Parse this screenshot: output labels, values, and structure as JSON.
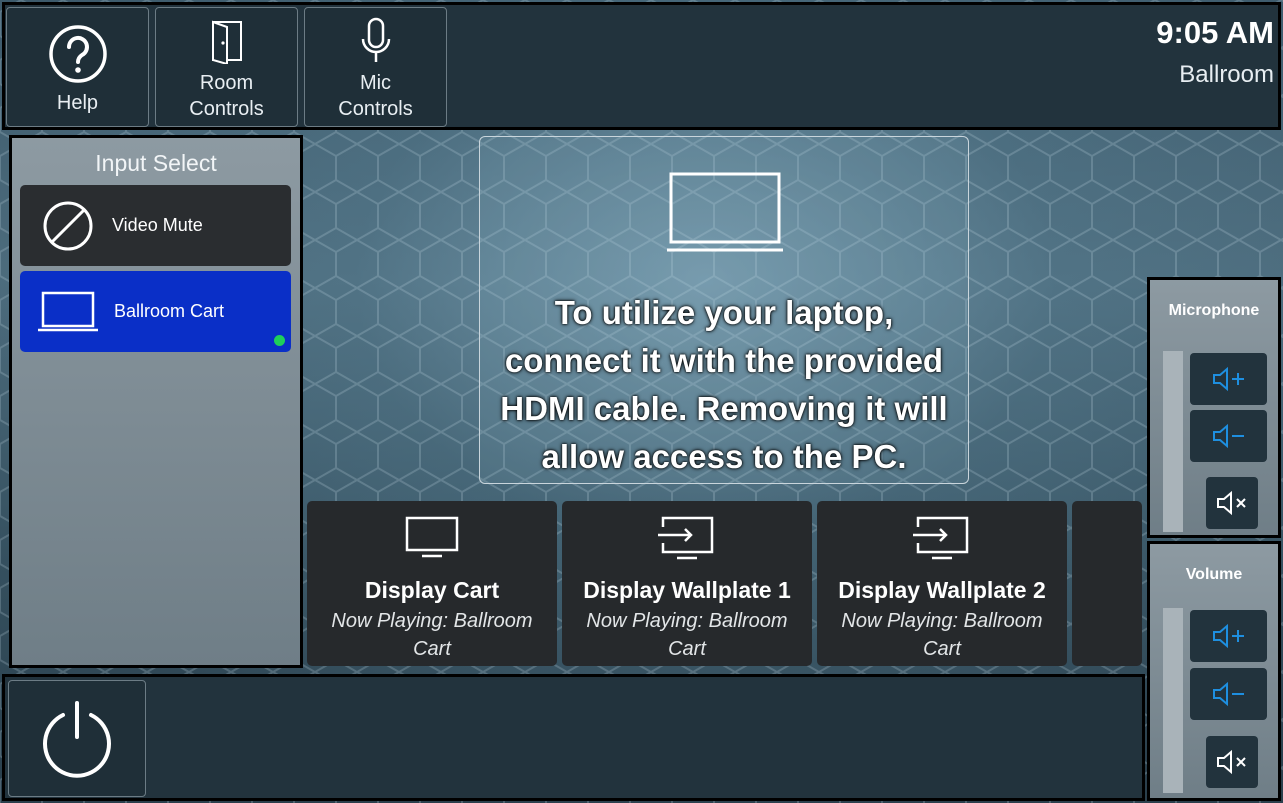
{
  "header": {
    "help_label": "Help",
    "room_controls_label_1": "Room",
    "room_controls_label_2": "Controls",
    "mic_controls_label_1": "Mic",
    "mic_controls_label_2": "Controls",
    "time": "9:05 AM",
    "room_name": "Ballroom"
  },
  "input_select": {
    "title": "Input Select",
    "sources": [
      {
        "label": "Video Mute",
        "icon": "video-mute-icon",
        "selected": false
      },
      {
        "label": "Ballroom Cart",
        "icon": "laptop-icon",
        "selected": true
      }
    ]
  },
  "info": {
    "icon": "laptop-icon",
    "message": "To utilize your laptop, connect it with the provided HDMI cable. Removing it will allow access to the PC."
  },
  "displays": [
    {
      "name": "Display Cart",
      "status": "Now Playing: Ballroom Cart",
      "icon": "monitor-icon"
    },
    {
      "name": "Display Wallplate 1",
      "status": "Now Playing: Ballroom Cart",
      "icon": "monitor-input-icon"
    },
    {
      "name": "Display Wallplate 2",
      "status": "Now Playing: Ballroom Cart",
      "icon": "monitor-input-icon"
    }
  ],
  "microphone": {
    "title": "Microphone"
  },
  "volume": {
    "title": "Volume"
  },
  "colors": {
    "accent_blue": "#0a2fc7",
    "active_dot": "#1ed05a",
    "volume_icon": "#1e8fe0"
  }
}
